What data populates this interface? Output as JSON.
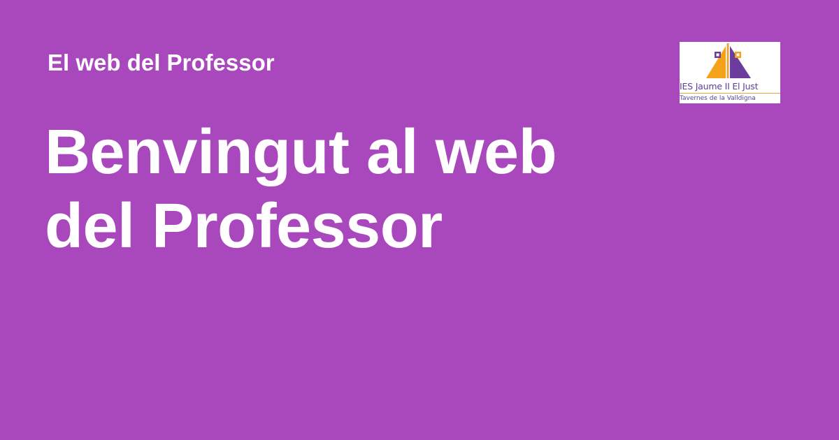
{
  "page": {
    "background_color": "#a947bc",
    "text_color": "#ffffff"
  },
  "header": {
    "site_name": "El web del Professor"
  },
  "hero": {
    "headline_line1": "Benvingut al web",
    "headline_line2": "del Professor"
  },
  "logo": {
    "icon": "pyramid-logo-icon",
    "name": "IES Jaume II El Just",
    "location": "Tavernes de la Valldigna",
    "colors": {
      "orange": "#f4a21c",
      "purple": "#6b3b9e",
      "text": "#5a3f97"
    }
  }
}
